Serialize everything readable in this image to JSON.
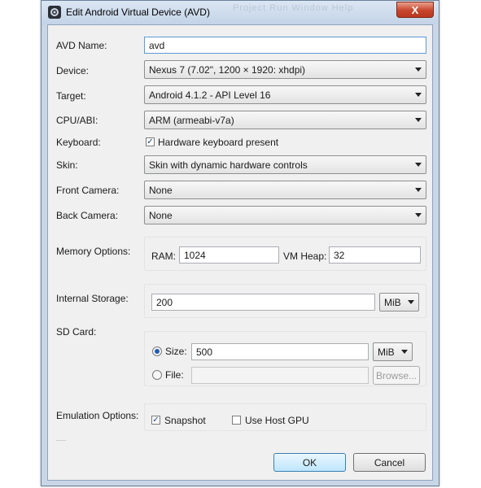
{
  "window": {
    "title": "Edit Android Virtual Device (AVD)",
    "close_glyph": "X",
    "bg_menu_text": "Project   Run   Window   Help"
  },
  "fields": {
    "avd_name": {
      "label": "AVD Name:",
      "value": "avd"
    },
    "device": {
      "label": "Device:",
      "value": "Nexus 7 (7.02\", 1200 × 1920: xhdpi)"
    },
    "target": {
      "label": "Target:",
      "value": "Android 4.1.2 - API Level 16"
    },
    "cpu_abi": {
      "label": "CPU/ABI:",
      "value": "ARM (armeabi-v7a)"
    },
    "keyboard": {
      "label": "Keyboard:",
      "checkbox_label": "Hardware keyboard present",
      "checked": true
    },
    "skin": {
      "label": "Skin:",
      "value": "Skin with dynamic hardware controls"
    },
    "front_camera": {
      "label": "Front Camera:",
      "value": "None"
    },
    "back_camera": {
      "label": "Back Camera:",
      "value": "None"
    }
  },
  "memory": {
    "label": "Memory Options:",
    "ram_label": "RAM:",
    "ram_value": "1024",
    "vmheap_label": "VM Heap:",
    "vmheap_value": "32"
  },
  "internal_storage": {
    "label": "Internal Storage:",
    "value": "200",
    "unit": "MiB"
  },
  "sd_card": {
    "label": "SD Card:",
    "size_label": "Size:",
    "size_value": "500",
    "size_unit": "MiB",
    "file_label": "File:",
    "file_value": "",
    "browse_label": "Browse...",
    "selected": "size"
  },
  "emulation": {
    "label": "Emulation Options:",
    "snapshot_label": "Snapshot",
    "snapshot_checked": true,
    "host_gpu_label": "Use Host GPU",
    "host_gpu_checked": false
  },
  "buttons": {
    "ok": "OK",
    "cancel": "Cancel"
  },
  "check_glyph": "✓"
}
